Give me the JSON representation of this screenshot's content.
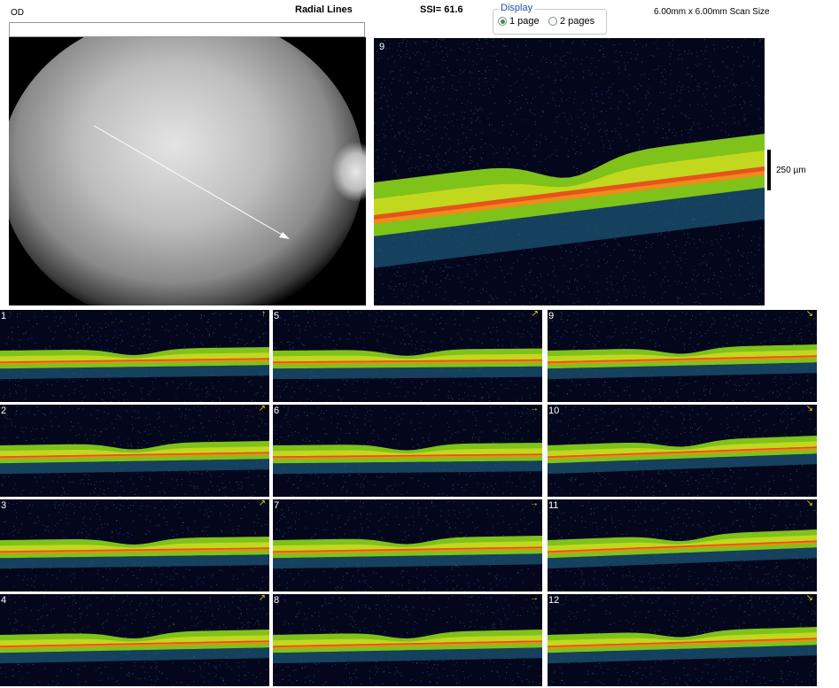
{
  "header": {
    "eye": "OD",
    "protocol": "Radial Lines",
    "ssi": "SSI= 61.6",
    "scan_size": "6.00mm x 6.00mm Scan Size"
  },
  "display": {
    "legend": "Display",
    "options": [
      "1 page",
      "2 pages"
    ],
    "selected": "1 page"
  },
  "main_scan": {
    "number": "9"
  },
  "scale": {
    "label": "250 µm"
  },
  "thumbnails": [
    {
      "number": "1",
      "arrow": "↑"
    },
    {
      "number": "2",
      "arrow": "↗"
    },
    {
      "number": "3",
      "arrow": "↗"
    },
    {
      "number": "4",
      "arrow": "↗"
    },
    {
      "number": "5",
      "arrow": "↗"
    },
    {
      "number": "6",
      "arrow": "→"
    },
    {
      "number": "7",
      "arrow": "→"
    },
    {
      "number": "8",
      "arrow": "→"
    },
    {
      "number": "9",
      "arrow": "↘"
    },
    {
      "number": "10",
      "arrow": "↘"
    },
    {
      "number": "11",
      "arrow": "↘"
    },
    {
      "number": "12",
      "arrow": "↘"
    }
  ],
  "colors": {
    "background_scan": "#04061c",
    "retina_green": "#7fc21a",
    "retina_yellow": "#d8df20",
    "rpe_red": "#e2461c",
    "rpe_orange": "#f08a1a",
    "selected_radio": "#2d9a2d"
  }
}
